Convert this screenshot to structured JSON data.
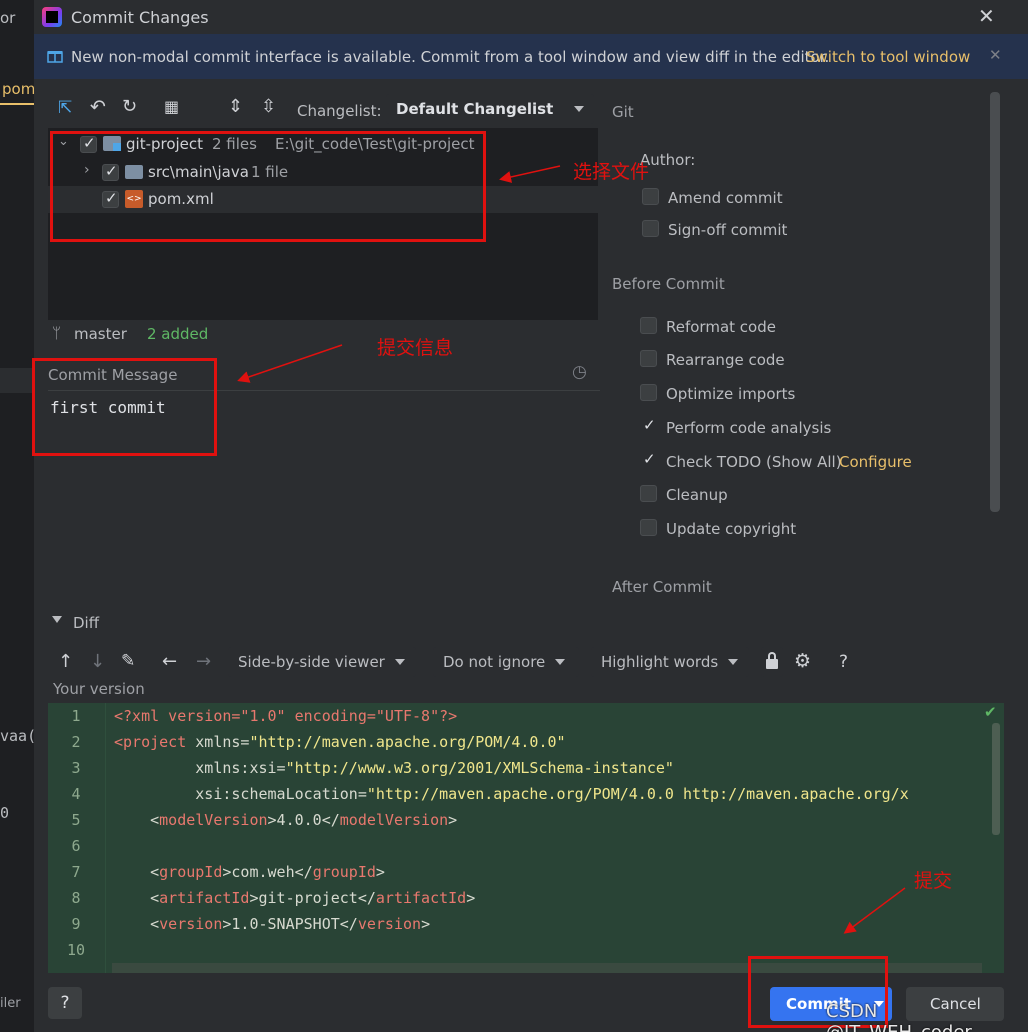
{
  "background_left": {
    "frag1": "or",
    "frag2": "pom",
    "frag3": "vaa(",
    "frag4": "0",
    "frag5": "iler"
  },
  "dialog": {
    "title": "Commit Changes",
    "banner": {
      "text": "New non-modal commit interface is available. Commit from a tool window and view diff in the editor.",
      "link": "Switch to tool window"
    },
    "toolbar": {
      "changelist_label": "Changelist:",
      "changelist_value": "Default Changelist"
    },
    "tree": {
      "root": {
        "name": "git-project",
        "count": "2 files",
        "path": "E:\\git_code\\Test\\git-project"
      },
      "folder": {
        "name": "src\\main\\java",
        "count": "1 file"
      },
      "file": {
        "name": "pom.xml"
      }
    },
    "branch": {
      "name": "master",
      "status": "2 added"
    },
    "commit_message": {
      "label": "Commit Message",
      "value": "first commit"
    },
    "git_panel": {
      "title": "Git",
      "author_label": "Author:",
      "amend": "Amend commit",
      "signoff": "Sign-off commit",
      "before_commit": "Before Commit",
      "options": [
        {
          "label": "Reformat code",
          "checked": false
        },
        {
          "label": "Rearrange code",
          "checked": false
        },
        {
          "label": "Optimize imports",
          "checked": false
        },
        {
          "label": "Perform code analysis",
          "checked": true
        },
        {
          "label": "Check TODO (Show All)",
          "checked": true,
          "link": "Configure"
        },
        {
          "label": "Cleanup",
          "checked": false
        },
        {
          "label": "Update copyright",
          "checked": false
        }
      ],
      "after_commit": "After Commit"
    },
    "diff": {
      "label": "Diff",
      "viewer": "Side-by-side viewer",
      "ignore": "Do not ignore",
      "highlight": "Highlight words",
      "help": "?",
      "your_version": "Your version"
    },
    "code_lines": [
      {
        "n": "1",
        "segs": [
          [
            "tag",
            "<?xml version=\"1.0\" encoding=\"UTF-8\"?>"
          ]
        ]
      },
      {
        "n": "2",
        "segs": [
          [
            "tag",
            "<project "
          ],
          [
            "attr",
            "xmlns="
          ],
          [
            "str",
            "\"http://maven.apache.org/POM/4.0.0\""
          ]
        ]
      },
      {
        "n": "3",
        "segs": [
          [
            "attr",
            "         xmlns:xsi="
          ],
          [
            "str",
            "\"http://www.w3.org/2001/XMLSchema-instance\""
          ]
        ]
      },
      {
        "n": "4",
        "segs": [
          [
            "attr",
            "         xsi:schemaLocation="
          ],
          [
            "str",
            "\"http://maven.apache.org/POM/4.0.0 http://maven.apache.org/x"
          ]
        ]
      },
      {
        "n": "5",
        "segs": [
          [
            "txt",
            "    <"
          ],
          [
            "tag",
            "modelVersion"
          ],
          [
            "txt",
            ">4.0.0</"
          ],
          [
            "tag",
            "modelVersion"
          ],
          [
            "txt",
            ">"
          ]
        ]
      },
      {
        "n": "6",
        "segs": []
      },
      {
        "n": "7",
        "segs": [
          [
            "txt",
            "    <"
          ],
          [
            "tag",
            "groupId"
          ],
          [
            "txt",
            ">com.weh</"
          ],
          [
            "tag",
            "groupId"
          ],
          [
            "txt",
            ">"
          ]
        ]
      },
      {
        "n": "8",
        "segs": [
          [
            "txt",
            "    <"
          ],
          [
            "tag",
            "artifactId"
          ],
          [
            "txt",
            ">git-project</"
          ],
          [
            "tag",
            "artifactId"
          ],
          [
            "txt",
            ">"
          ]
        ]
      },
      {
        "n": "9",
        "segs": [
          [
            "txt",
            "    <"
          ],
          [
            "tag",
            "version"
          ],
          [
            "txt",
            ">1.0-SNAPSHOT</"
          ],
          [
            "tag",
            "version"
          ],
          [
            "txt",
            ">"
          ]
        ]
      },
      {
        "n": "10",
        "segs": []
      }
    ],
    "footer": {
      "help": "?",
      "commit": "Commit",
      "cancel": "Cancel"
    }
  },
  "annotations": {
    "select_files": "选择文件",
    "commit_info": "提交信息",
    "commit": "提交"
  },
  "watermark": "CSDN @IT_WEH_coder",
  "colors": {
    "dialog_bg": "#2b2d30",
    "banner_bg": "#25324d",
    "link": "#e8bf6a",
    "diff_green": "#294436",
    "annotation": "#e0110f"
  }
}
